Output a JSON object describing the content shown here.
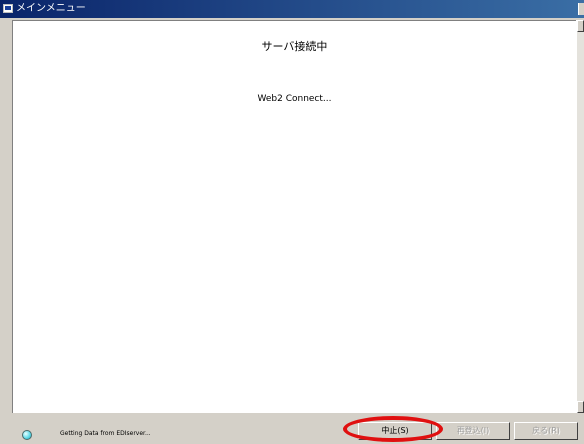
{
  "window": {
    "title": "メインメニュー",
    "icon": "app-window-icon"
  },
  "content": {
    "heading": "サーバ接続中",
    "message": "Web2 Connect..."
  },
  "status": {
    "text": "Getting Data from EDIserver...",
    "indicator_color": "#58d8e8"
  },
  "buttons": {
    "stop": "中止(S)",
    "register": "再登込(I)",
    "back": "戻る(R)"
  },
  "annotation": {
    "color": "#e01010"
  }
}
